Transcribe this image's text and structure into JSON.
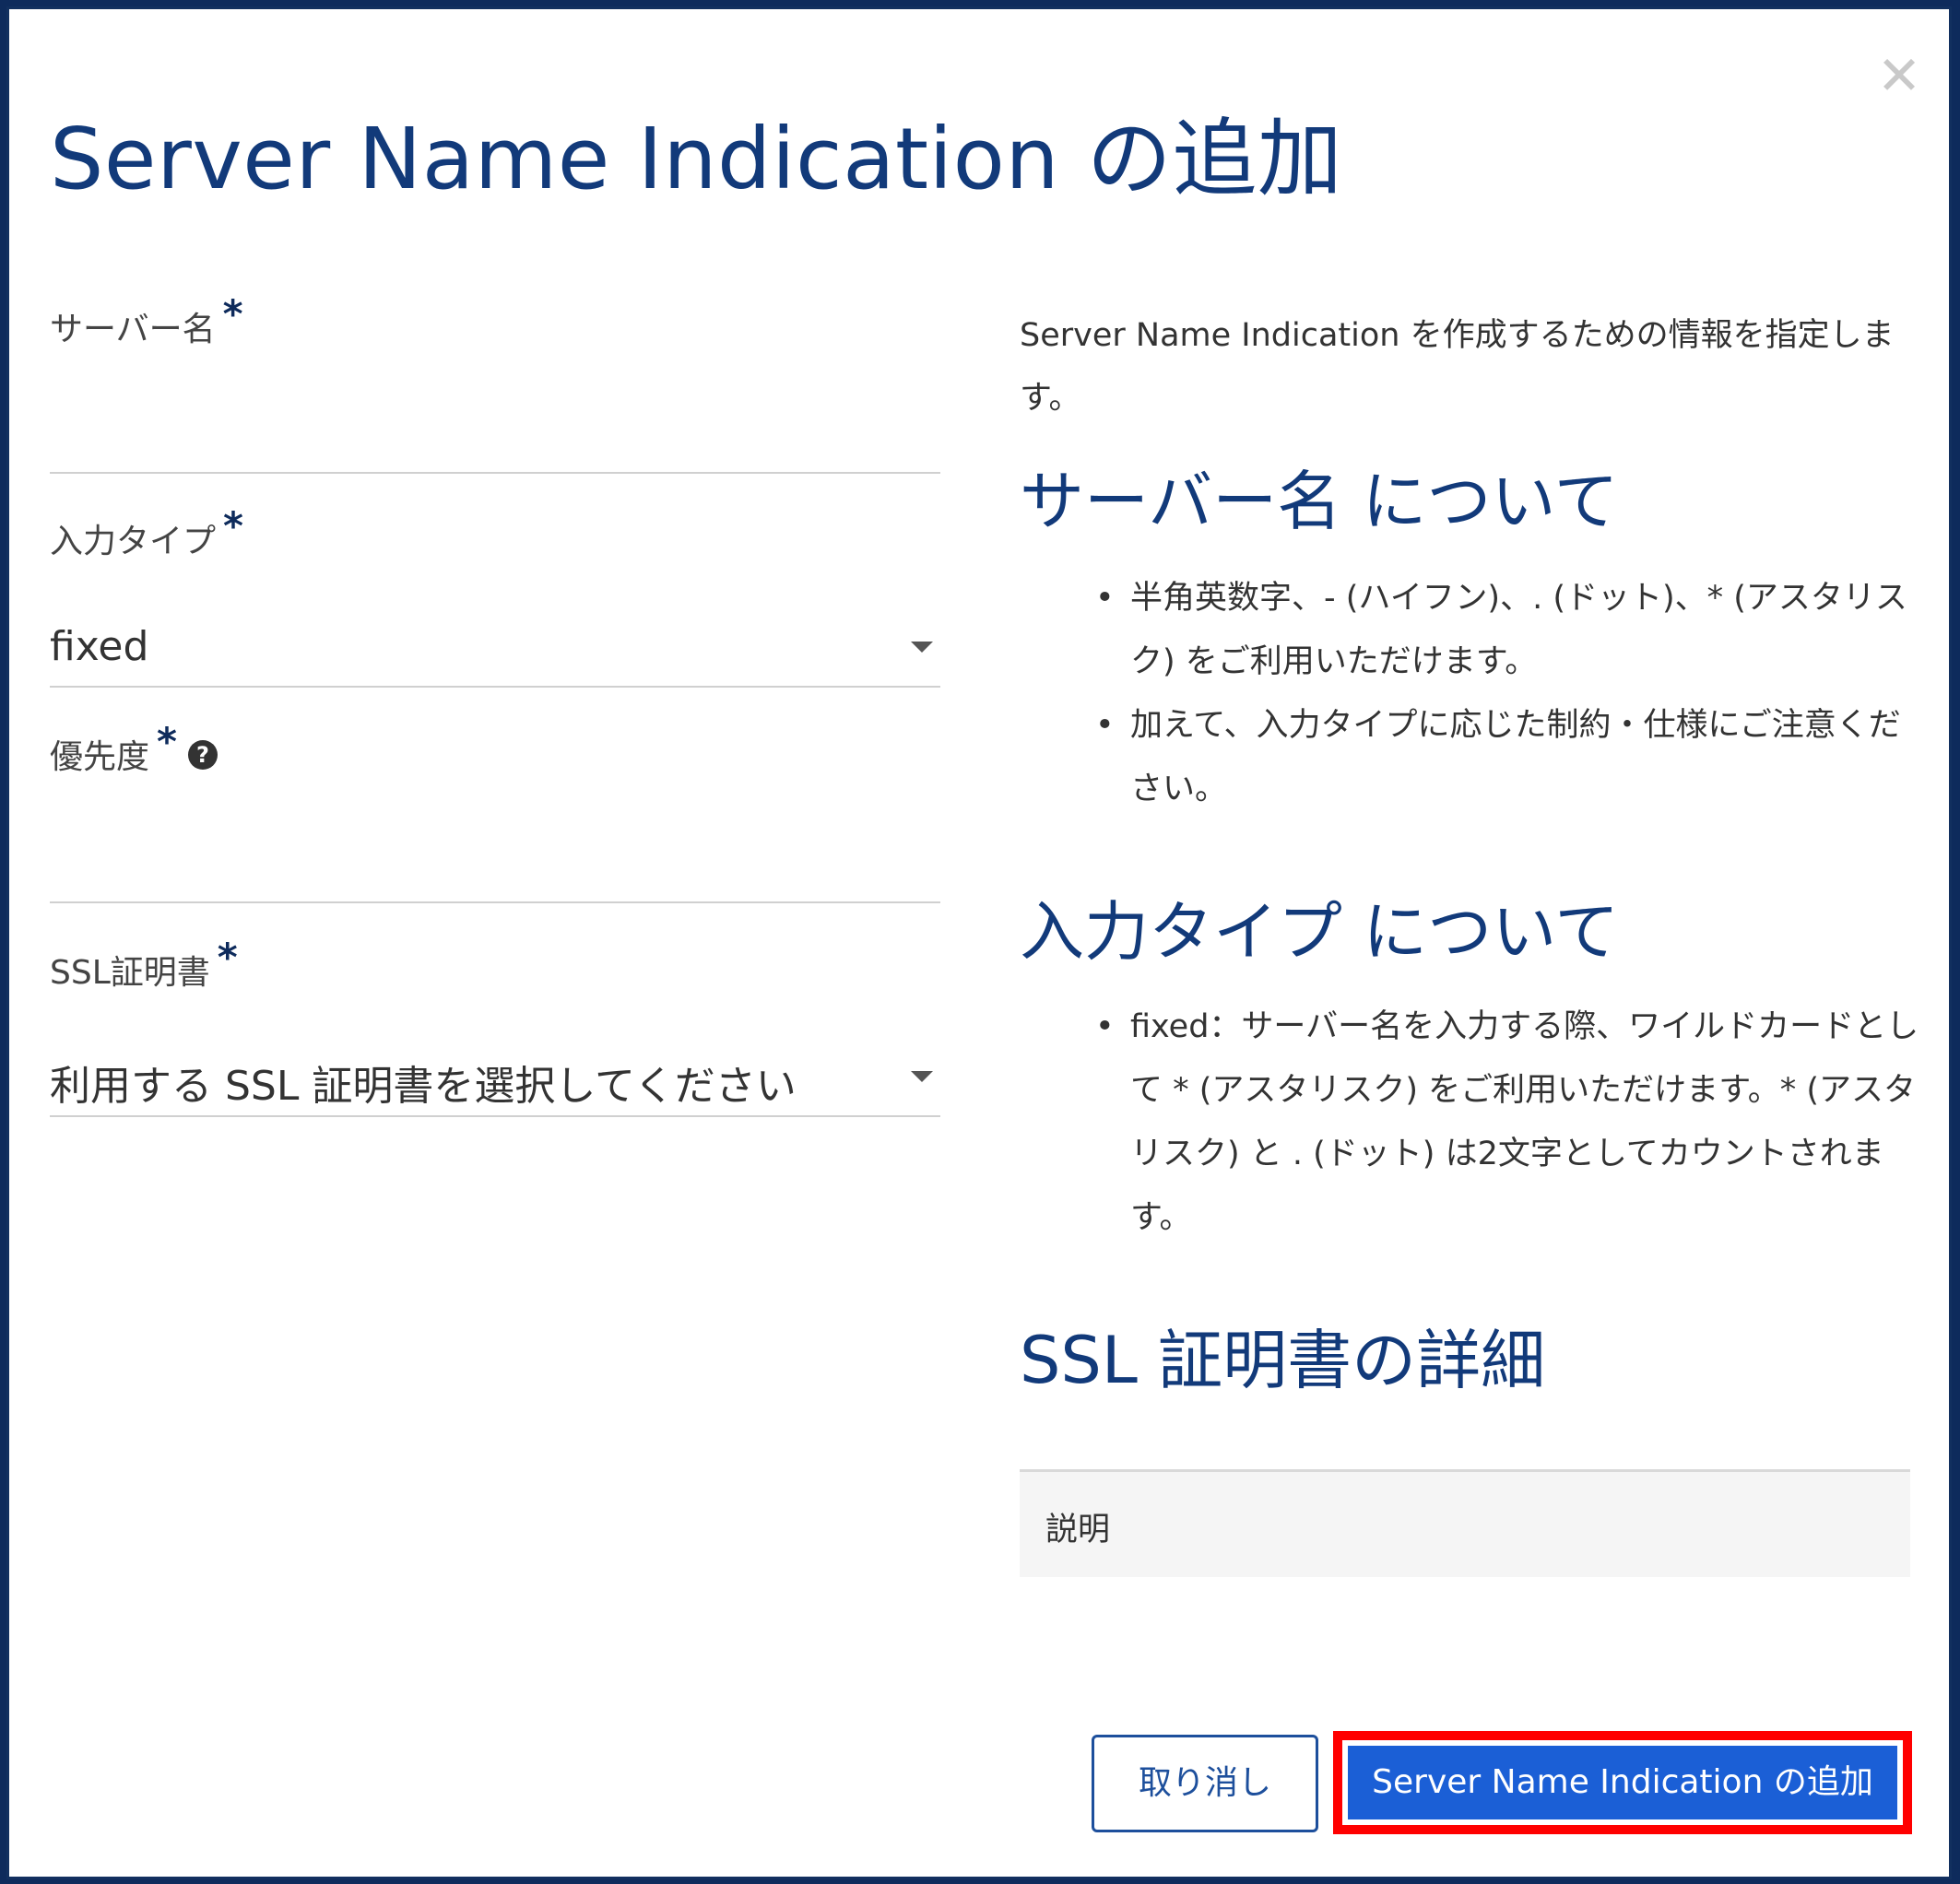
{
  "dialog": {
    "title": "Server Name Indication の追加",
    "close_icon": "close-icon"
  },
  "form": {
    "server_name": {
      "label": "サーバー名",
      "required_mark": "*",
      "value": ""
    },
    "input_type": {
      "label": "入力タイプ",
      "required_mark": "*",
      "selected": "fixed"
    },
    "priority": {
      "label": "優先度",
      "required_mark": "*",
      "help_icon": "question-circle-icon",
      "help_glyph": "?",
      "value": ""
    },
    "ssl_cert": {
      "label": "SSL証明書",
      "required_mark": "*",
      "selected": "利用する SSL 証明書を選択してください"
    }
  },
  "help": {
    "intro": "Server Name Indication を作成するための情報を指定します。",
    "sections": [
      {
        "heading": "サーバー名 について",
        "items": [
          "半角英数字、- (ハイフン)、. (ドット)、* (アスタリスク) をご利用いただけます。",
          "加えて、入力タイプに応じた制約・仕様にご注意ください。"
        ]
      },
      {
        "heading": "入力タイプ について",
        "items": [
          "fixed：サーバー名を入力する際、ワイルドカードとして * (アスタリスク) をご利用いただけます。* (アスタリスク) と . (ドット) は2文字としてカウントされます。"
        ]
      },
      {
        "heading": "SSL 証明書の詳細",
        "table_label": "説明"
      }
    ]
  },
  "footer": {
    "cancel_label": "取り消し",
    "submit_label": "Server Name Indication の追加",
    "highlight_color": "#ff0000"
  },
  "colors": {
    "title": "#123a7a",
    "primary": "#1b5fd6",
    "border": "#12305f"
  }
}
